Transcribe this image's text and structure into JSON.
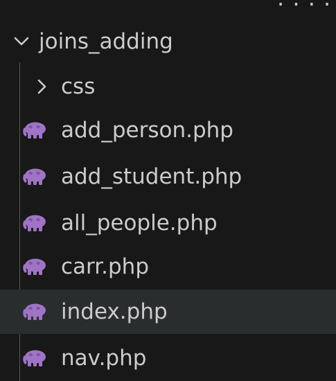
{
  "explorer": {
    "root_folder": {
      "label": "joins_adding",
      "expanded": true,
      "icon": "chevron-down-icon"
    },
    "subfolder": {
      "label": "css",
      "expanded": false,
      "icon": "chevron-right-icon"
    },
    "files": [
      {
        "label": "add_person.php",
        "icon": "php-elephant-icon"
      },
      {
        "label": "add_student.php",
        "icon": "php-elephant-icon"
      },
      {
        "label": "all_people.php",
        "icon": "php-elephant-icon"
      },
      {
        "label": "carr.php",
        "icon": "php-elephant-icon"
      },
      {
        "label": "index.php",
        "icon": "php-elephant-icon",
        "selected": true
      },
      {
        "label": "nav.php",
        "icon": "php-elephant-icon"
      }
    ]
  },
  "colors": {
    "background": "#181818",
    "text": "#cccccc",
    "selected_row": "#2a2d2e",
    "php_icon": "#a074c4",
    "indent_guide": "#585858"
  }
}
